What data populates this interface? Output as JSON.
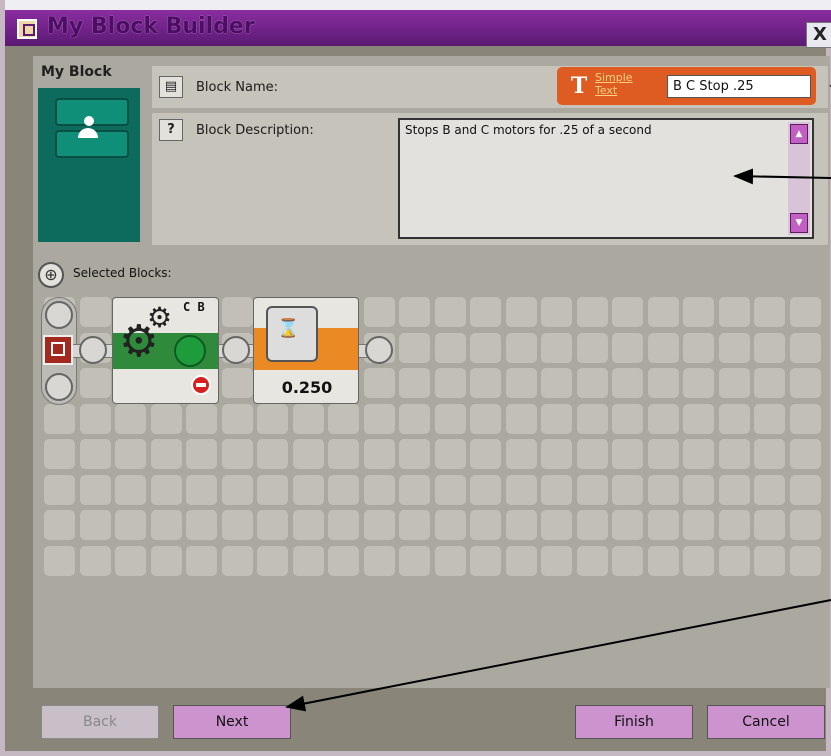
{
  "window": {
    "title": "My Block Builder",
    "close_label": "X"
  },
  "sidebar": {
    "title": "My Block"
  },
  "block_name": {
    "label": "Block Name:",
    "simple_text_link": "Simple Text",
    "value": "B C Stop .25"
  },
  "block_description": {
    "label": "Block Description:",
    "value": "Stops B and C motors for .25 of a second"
  },
  "selected_blocks": {
    "label": "Selected Blocks:",
    "motor_block": {
      "ports": "C B"
    },
    "wait_block": {
      "value": "0.250"
    }
  },
  "buttons": {
    "back": "Back",
    "next": "Next",
    "finish": "Finish",
    "cancel": "Cancel"
  },
  "colors": {
    "title_bar": "#6b2285",
    "accent_orange": "#de5c22",
    "button_pink": "#cd93cf",
    "motor_green": "#2f8a3c"
  }
}
